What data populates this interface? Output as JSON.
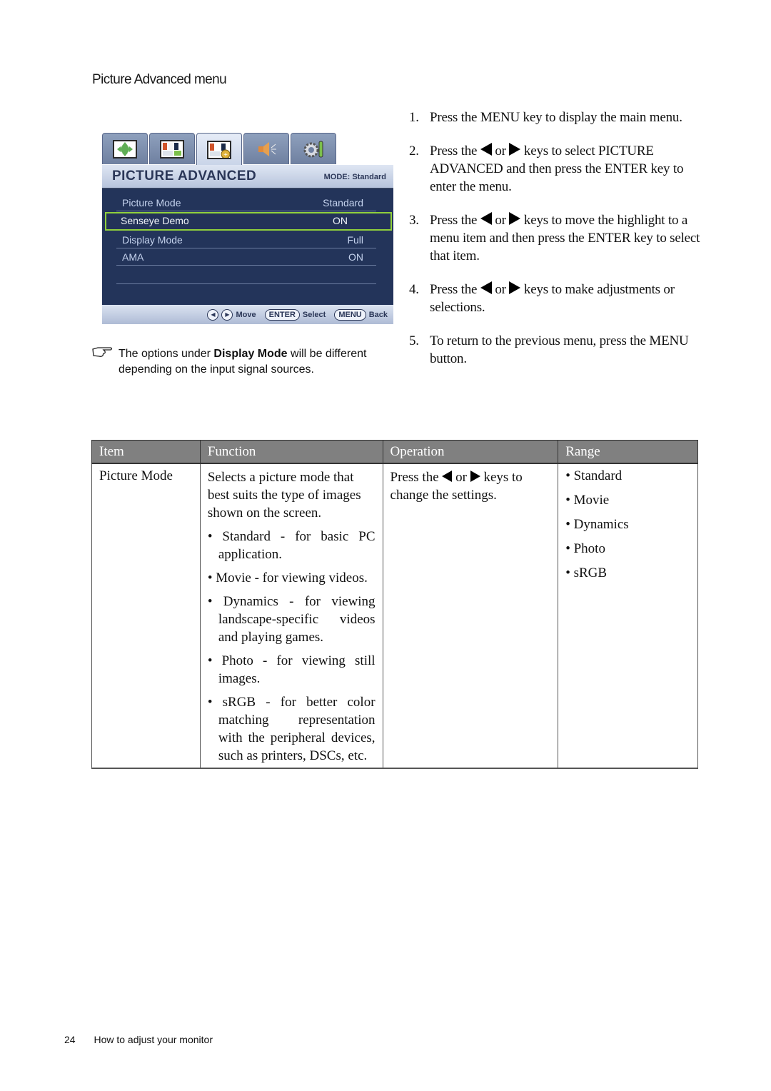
{
  "section_title": "Picture Advanced menu",
  "osd": {
    "tabs": [
      {
        "icon": "display-position-icon",
        "active": false
      },
      {
        "icon": "picture-icon",
        "active": false
      },
      {
        "icon": "picture-advanced-icon",
        "active": true
      },
      {
        "icon": "audio-icon",
        "active": false
      },
      {
        "icon": "system-settings-icon",
        "active": false
      }
    ],
    "title": "PICTURE ADVANCED",
    "mode_label": "MODE: Standard",
    "rows": [
      {
        "label": "Picture Mode",
        "value": "Standard",
        "selected": false
      },
      {
        "label": "Senseye Demo",
        "value": "ON",
        "selected": true
      },
      {
        "label": "Display Mode",
        "value": "Full",
        "selected": false
      },
      {
        "label": "AMA",
        "value": "ON",
        "selected": false
      }
    ],
    "footer": {
      "move_label": "Move",
      "enter_key": "ENTER",
      "select_label": "Select",
      "menu_key": "MENU",
      "back_label": "Back"
    },
    "colors": {
      "body": "#23345a",
      "highlight": "#8fcf3c"
    }
  },
  "note": {
    "text_before": "The options under ",
    "bold": "Display Mode",
    "text_after": " will be different depending on the input signal sources."
  },
  "steps": [
    {
      "num": "1.",
      "parts": [
        "Press the ",
        "MENU",
        " key to display the main menu."
      ]
    },
    {
      "num": "2.",
      "a": "Press the ",
      "b": " or ",
      "c": " keys to select ",
      "d": "PICTURE ADVANCED",
      "e": " and then press the ",
      "f": "ENTER",
      "g": " key to enter the menu."
    },
    {
      "num": "3.",
      "a": "Press the ",
      "b": " or ",
      "c": " keys to move the highlight to a menu item and then press the ",
      "d": "ENTER",
      "e": " key to select that item."
    },
    {
      "num": "4.",
      "a": "Press the ",
      "b": " or ",
      "c": " keys to make adjustments or selections."
    },
    {
      "num": "5.",
      "a": "To return to the previous menu, press the ",
      "b": "MENU",
      "c": " button."
    }
  ],
  "table": {
    "headers": [
      "Item",
      "Function",
      "Operation",
      "Range"
    ],
    "rows": [
      {
        "item": "Picture Mode",
        "function_intro": "Selects a picture mode that best suits the type of images shown on the screen.",
        "function_bullets": [
          "• Standard - for basic PC application.",
          "• Movie - for viewing videos.",
          "• Dynamics - for viewing landscape-specific videos and playing games.",
          "• Photo - for viewing still images.",
          "• sRGB - for better color matching representation with the peripheral devices, such as printers, DSCs, etc."
        ],
        "operation": {
          "a": "Press the ",
          "b": " or ",
          "c": " keys to change the settings."
        },
        "range": [
          "• Standard",
          "• Movie",
          "• Dynamics",
          "• Photo",
          "• sRGB"
        ]
      }
    ]
  },
  "footer": {
    "page_number": "24",
    "chapter": "How to adjust your monitor"
  }
}
